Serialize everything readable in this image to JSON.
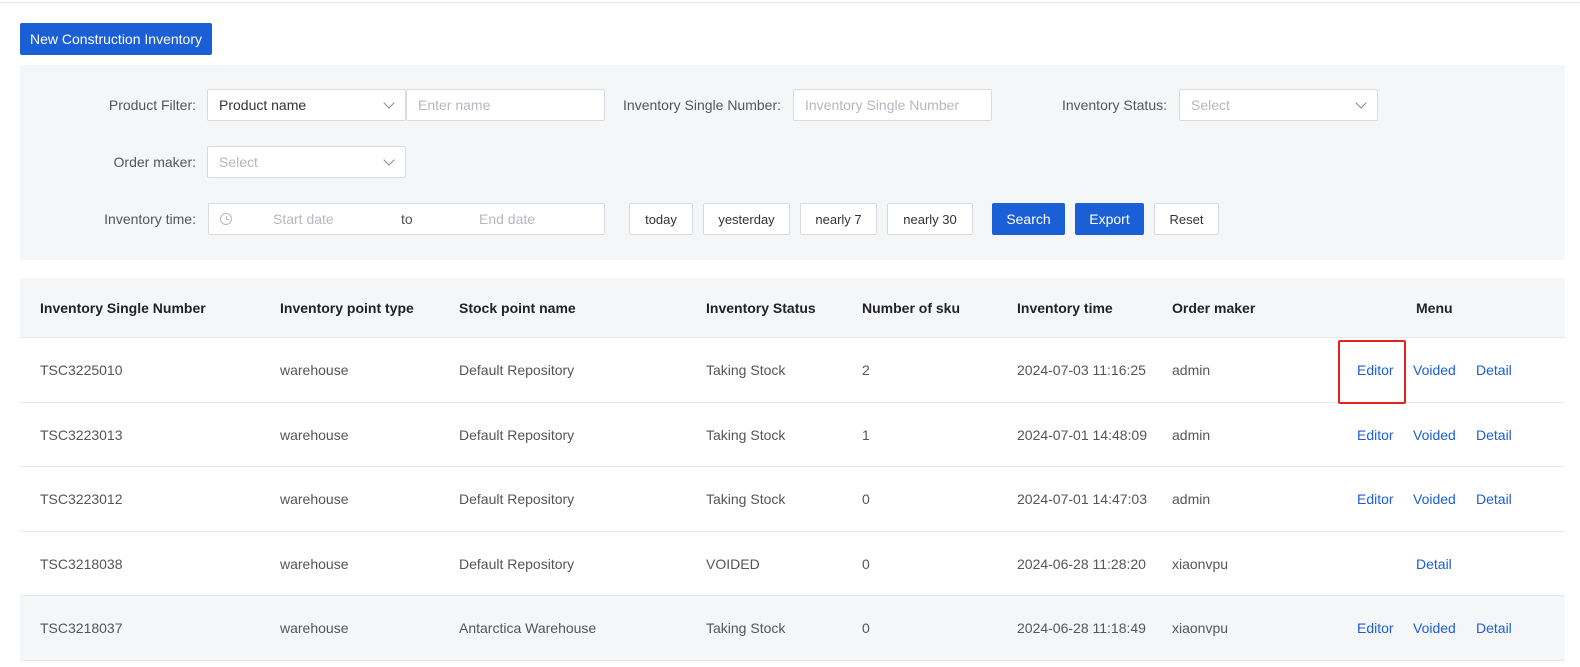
{
  "header": {
    "new_button": "New Construction Inventory"
  },
  "filters": {
    "product_filter_label": "Product Filter:",
    "product_filter_select": "Product name",
    "product_name_placeholder": "Enter name",
    "inventory_number_label": "Inventory Single Number:",
    "inventory_number_placeholder": "Inventory Single Number",
    "inventory_status_label": "Inventory Status:",
    "inventory_status_placeholder": "Select",
    "order_maker_label": "Order maker:",
    "order_maker_placeholder": "Select",
    "inventory_time_label": "Inventory time:",
    "start_date_placeholder": "Start date",
    "range_separator": "to",
    "end_date_placeholder": "End date",
    "quick_ranges": [
      "today",
      "yesterday",
      "nearly 7",
      "nearly 30"
    ],
    "search_button": "Search",
    "export_button": "Export",
    "reset_button": "Reset"
  },
  "table": {
    "columns": [
      "Inventory Single Number",
      "Inventory point type",
      "Stock point name",
      "Inventory Status",
      "Number of sku",
      "Inventory time",
      "Order maker",
      "Menu"
    ],
    "rows": [
      {
        "number": "TSC3225010",
        "type": "warehouse",
        "stock_point": "Default Repository",
        "status": "Taking Stock",
        "sku": "2",
        "time": "2024-07-03 11:16:25",
        "maker": "admin",
        "actions": [
          "Editor",
          "Voided",
          "Detail"
        ]
      },
      {
        "number": "TSC3223013",
        "type": "warehouse",
        "stock_point": "Default Repository",
        "status": "Taking Stock",
        "sku": "1",
        "time": "2024-07-01 14:48:09",
        "maker": "admin",
        "actions": [
          "Editor",
          "Voided",
          "Detail"
        ]
      },
      {
        "number": "TSC3223012",
        "type": "warehouse",
        "stock_point": "Default Repository",
        "status": "Taking Stock",
        "sku": "0",
        "time": "2024-07-01 14:47:03",
        "maker": "admin",
        "actions": [
          "Editor",
          "Voided",
          "Detail"
        ]
      },
      {
        "number": "TSC3218038",
        "type": "warehouse",
        "stock_point": "Default Repository",
        "status": "VOIDED",
        "sku": "0",
        "time": "2024-06-28 11:28:20",
        "maker": "xiaonvpu",
        "actions": [
          "Detail"
        ]
      },
      {
        "number": "TSC3218037",
        "type": "warehouse",
        "stock_point": "Antarctica Warehouse",
        "status": "Taking Stock",
        "sku": "0",
        "time": "2024-06-28 11:18:49",
        "maker": "xiaonvpu",
        "actions": [
          "Editor",
          "Voided",
          "Detail"
        ]
      }
    ]
  },
  "colors": {
    "primary": "#1a5fd6",
    "highlight": "#e82020",
    "panel_bg": "#f5f6f8"
  }
}
